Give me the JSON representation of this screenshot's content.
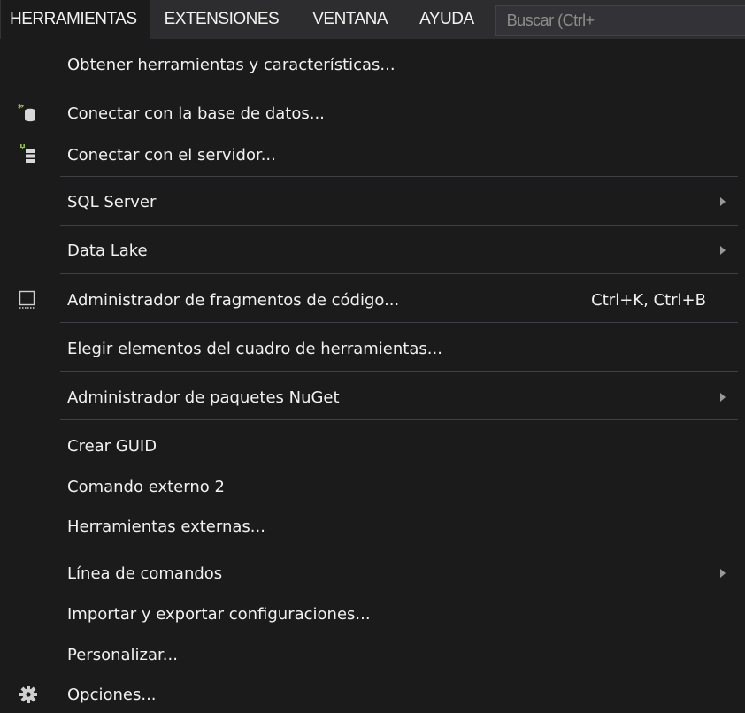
{
  "menubar": {
    "items": [
      "HERRAMIENTAS",
      "EXTENSIONES",
      "VENTANA",
      "AYUDA"
    ],
    "active_index": 0,
    "search_placeholder": "Buscar (Ctrl+"
  },
  "menu": {
    "items": [
      {
        "label": "Obtener herramientas y características...",
        "icon": "",
        "shortcut": "",
        "submenu": false
      },
      {
        "label": "Conectar con la base de datos...",
        "icon": "database-connect-icon",
        "shortcut": "",
        "submenu": false
      },
      {
        "label": "Conectar con el servidor...",
        "icon": "server-connect-icon",
        "shortcut": "",
        "submenu": false
      },
      {
        "label": "SQL Server",
        "icon": "",
        "shortcut": "",
        "submenu": true
      },
      {
        "label": "Data Lake",
        "icon": "",
        "shortcut": "",
        "submenu": true
      },
      {
        "label": "Administrador de fragmentos de código...",
        "icon": "snippet-icon",
        "shortcut": "Ctrl+K, Ctrl+B",
        "submenu": false
      },
      {
        "label": "Elegir elementos del cuadro de herramientas...",
        "icon": "",
        "shortcut": "",
        "submenu": false
      },
      {
        "label": "Administrador de paquetes NuGet",
        "icon": "",
        "shortcut": "",
        "submenu": true
      },
      {
        "label": "Crear GUID",
        "icon": "",
        "shortcut": "",
        "submenu": false
      },
      {
        "label": "Comando externo 2",
        "icon": "",
        "shortcut": "",
        "submenu": false
      },
      {
        "label": "Herramientas externas...",
        "icon": "",
        "shortcut": "",
        "submenu": false
      },
      {
        "label": "Línea de comandos",
        "icon": "",
        "shortcut": "",
        "submenu": true
      },
      {
        "label": "Importar y exportar configuraciones...",
        "icon": "",
        "shortcut": "",
        "submenu": false
      },
      {
        "label": "Personalizar...",
        "icon": "",
        "shortcut": "",
        "submenu": false
      },
      {
        "label": "Opciones...",
        "icon": "gear-icon",
        "shortcut": "",
        "submenu": false
      }
    ]
  },
  "colors": {
    "menu_background": "#1b1b1c",
    "menubar_background": "#2d2d30",
    "separator": "#3f3f46",
    "text": "#f1f1f1",
    "icon_green": "#8bc34a"
  }
}
